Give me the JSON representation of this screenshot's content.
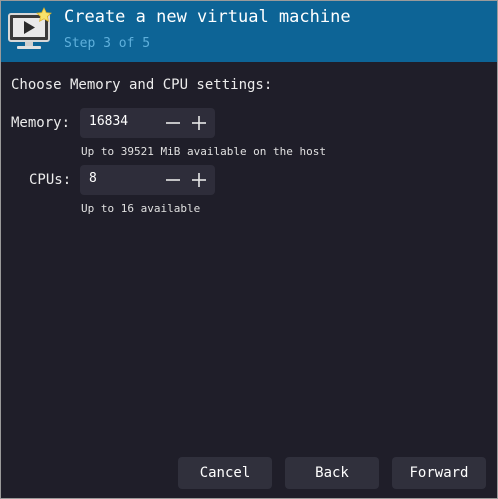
{
  "header": {
    "title": "Create a new virtual machine",
    "subtitle": "Step 3 of 5",
    "icon": "vm-monitor-icon",
    "color": "#0d6496"
  },
  "main": {
    "heading": "Choose Memory and CPU settings:",
    "memory": {
      "label": "Memory:",
      "value": "16834",
      "hint": "Up to 39521 MiB available on the host"
    },
    "cpus": {
      "label": "CPUs:",
      "value": "8",
      "hint": "Up to 16 available"
    }
  },
  "buttons": {
    "cancel": "Cancel",
    "back": "Back",
    "forward": "Forward"
  }
}
